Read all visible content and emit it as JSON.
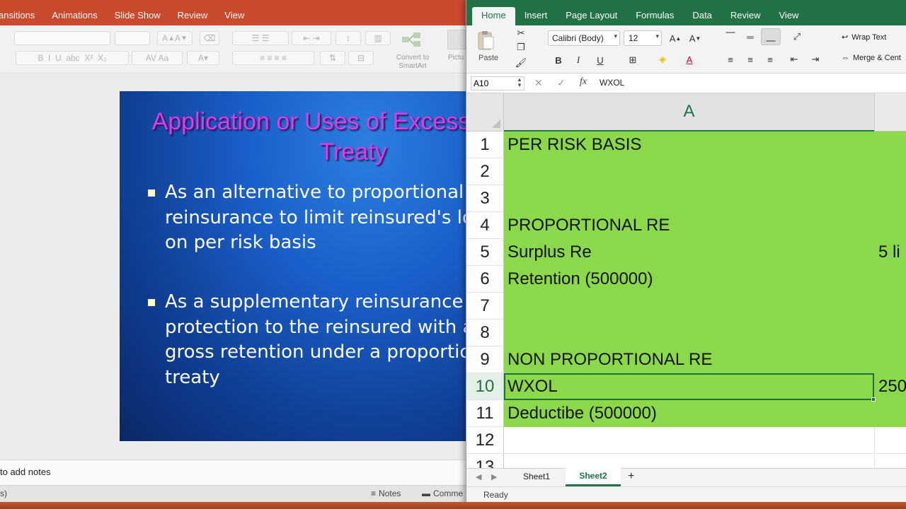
{
  "powerpoint": {
    "tabs": [
      "ansitions",
      "Animations",
      "Slide Show",
      "Review",
      "View"
    ],
    "convert_smartart": "Convert to SmartArt",
    "picture_label": "Pictu",
    "slide": {
      "title": "Application or Uses of Excess of Loss Treaty",
      "bullets": [
        "As an alternative to proportional\nreinsurance to limit reinsured's loss\non per risk basis",
        "As a supplementary reinsurance\nprotection to the reinsured with a\ngross retention under a proportional\ntreaty"
      ]
    },
    "notes_hint": "to add notes",
    "status_left": "s)",
    "notes_button": "Notes",
    "comments_button": "Comme"
  },
  "excel": {
    "tabs": [
      "Home",
      "Insert",
      "Page Layout",
      "Formulas",
      "Data",
      "Review",
      "View"
    ],
    "active_tab": "Home",
    "paste_label": "Paste",
    "font_name": "Calibri (Body)",
    "font_size": "12",
    "wrap_text": "Wrap Text",
    "merge_center": "Merge & Cent",
    "name_box": "A10",
    "formula_value": "WXOL",
    "column_header": "A",
    "rows": [
      {
        "num": "1",
        "a": "PER RISK BASIS",
        "b": "",
        "fill": "green"
      },
      {
        "num": "2",
        "a": "",
        "b": "",
        "fill": "green"
      },
      {
        "num": "3",
        "a": "",
        "b": "",
        "fill": "green"
      },
      {
        "num": "4",
        "a": "PROPORTIONAL RE",
        "b": "",
        "fill": "green"
      },
      {
        "num": "5",
        "a": "Surplus Re",
        "b": "5 li",
        "fill": "green"
      },
      {
        "num": "6",
        "a": "Retention (500000)",
        "b": "",
        "fill": "green"
      },
      {
        "num": "7",
        "a": "",
        "b": "",
        "fill": "green"
      },
      {
        "num": "8",
        "a": "",
        "b": "",
        "fill": "green"
      },
      {
        "num": "9",
        "a": "NON PROPORTIONAL RE",
        "b": "",
        "fill": "green"
      },
      {
        "num": "10",
        "a": "WXOL",
        "b": "250",
        "fill": "green"
      },
      {
        "num": "11",
        "a": "Deductibe (500000)",
        "b": "",
        "fill": "green"
      },
      {
        "num": "12",
        "a": "",
        "b": "",
        "fill": "white"
      },
      {
        "num": "13",
        "a": "",
        "b": "",
        "fill": "white"
      }
    ],
    "sheets": [
      "Sheet1",
      "Sheet2"
    ],
    "active_sheet": "Sheet2",
    "status": "Ready",
    "colors": {
      "accent": "#217346",
      "fill_green": "#8bd94a"
    }
  }
}
